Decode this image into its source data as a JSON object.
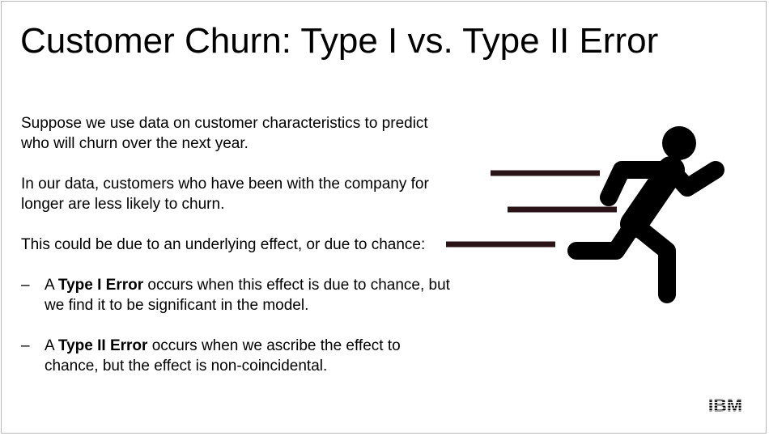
{
  "slide": {
    "title": "Customer Churn: Type I vs. Type II Error",
    "paragraphs": [
      "Suppose we use data on customer characteristics to predict who will churn over the next year.",
      "In our data, customers who have been with the company for longer are less likely to churn.",
      "This could be due to an underlying effect, or due to chance:"
    ],
    "bullets": [
      {
        "dash": "–",
        "prefix": "A ",
        "term": "Type I Error",
        "suffix": " occurs when this effect is due to chance, but we find it to be significant in the model."
      },
      {
        "dash": "–",
        "prefix": "A ",
        "term": "Type II Error",
        "suffix": " occurs when we ascribe the effect to chance, but the effect is non-coincidental."
      }
    ]
  },
  "illustration": {
    "icon": "running-person-icon",
    "color": "#000000",
    "speed_line_color": "#2a1418"
  },
  "logo": {
    "text": "IBM",
    "icon": "ibm-logo-icon",
    "color": "#000000"
  }
}
